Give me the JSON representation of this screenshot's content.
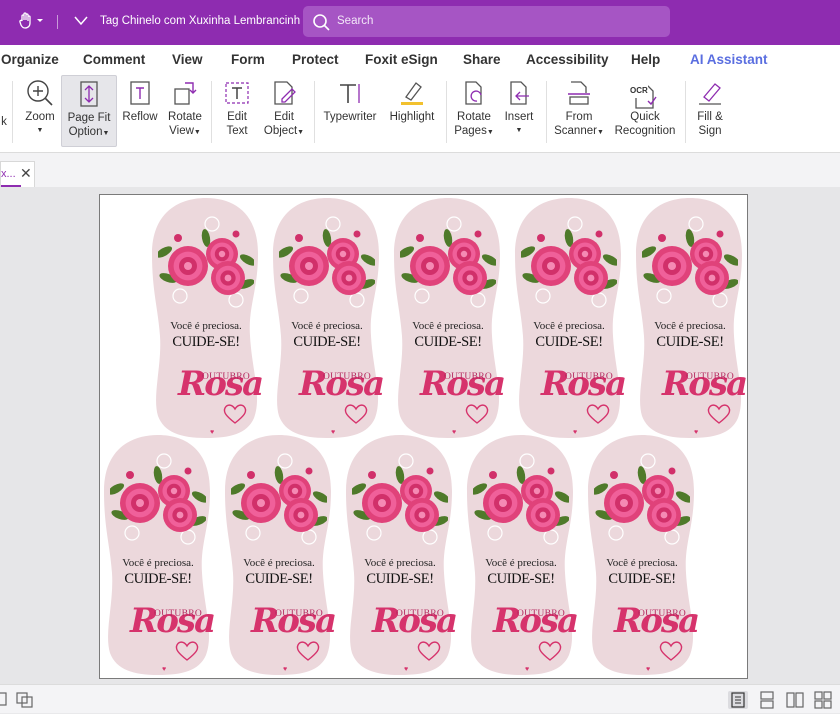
{
  "window": {
    "title": "Tag Chinelo com Xuxinha Lembrancinha",
    "search_placeholder": "Search"
  },
  "menu": [
    {
      "label": "Organize"
    },
    {
      "label": "Comment"
    },
    {
      "label": "View"
    },
    {
      "label": "Form"
    },
    {
      "label": "Protect"
    },
    {
      "label": "Foxit eSign"
    },
    {
      "label": "Share"
    },
    {
      "label": "Accessibility"
    },
    {
      "label": "Help"
    },
    {
      "label": "AI Assistant"
    }
  ],
  "ribbon": {
    "cut_label": "k",
    "zoom": "Zoom",
    "page_fit_1": "Page Fit",
    "page_fit_2": "Option",
    "reflow": "Reflow",
    "rotate_view_1": "Rotate",
    "rotate_view_2": "View",
    "edit_text_1": "Edit",
    "edit_text_2": "Text",
    "edit_object_1": "Edit",
    "edit_object_2": "Object",
    "typewriter": "Typewriter",
    "highlight": "Highlight",
    "rotate_pages_1": "Rotate",
    "rotate_pages_2": "Pages",
    "insert": "Insert",
    "from_scanner_1": "From",
    "from_scanner_2": "Scanner",
    "quick_recognition_1": "Quick",
    "quick_recognition_2": "Recognition",
    "ocr_badge": "OCR",
    "fill_sign_1": "Fill &",
    "fill_sign_2": "Sign"
  },
  "document_tab": {
    "label": "x...",
    "close": "✕"
  },
  "tag": {
    "line1": "Você é preciosa.",
    "line2": "CUIDE-SE!",
    "line3": "OUTUBRO",
    "line4": "Rosa"
  },
  "colors": {
    "titlebar": "#8e2cb0",
    "accent_pink": "#d6336c",
    "tag_background": "#ecd8dc",
    "ai_assistant": "#5a6ee0"
  }
}
